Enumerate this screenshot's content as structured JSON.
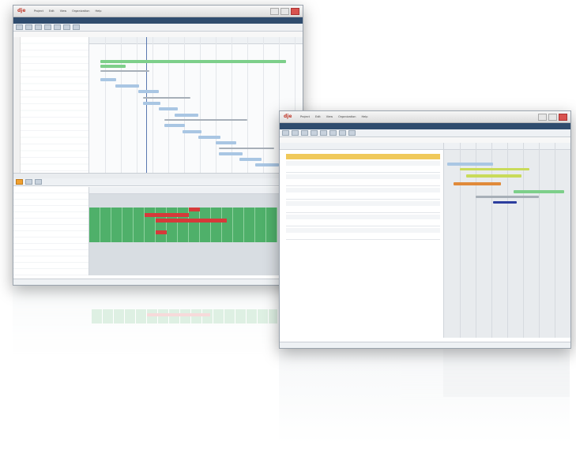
{
  "window_left": {
    "menu": [
      "Project",
      "Edit",
      "View",
      "Organization",
      "Help"
    ]
  },
  "window_right": {
    "menu": [
      "Project",
      "Edit",
      "View",
      "Organization",
      "Help"
    ]
  },
  "colors": {
    "nav": "#2f4c6e",
    "bar_green": "#7dcf8a",
    "bar_blue": "#a9c6e3",
    "bar_gray": "#a7afb8",
    "cell_green": "#4fb06a",
    "cell_red": "#d63a3a",
    "summary_yellow": "#f0c95a",
    "bar_orange": "#e08a3a",
    "bar_yellowgreen": "#c9db5a",
    "bar_navy": "#2c3e9e"
  }
}
